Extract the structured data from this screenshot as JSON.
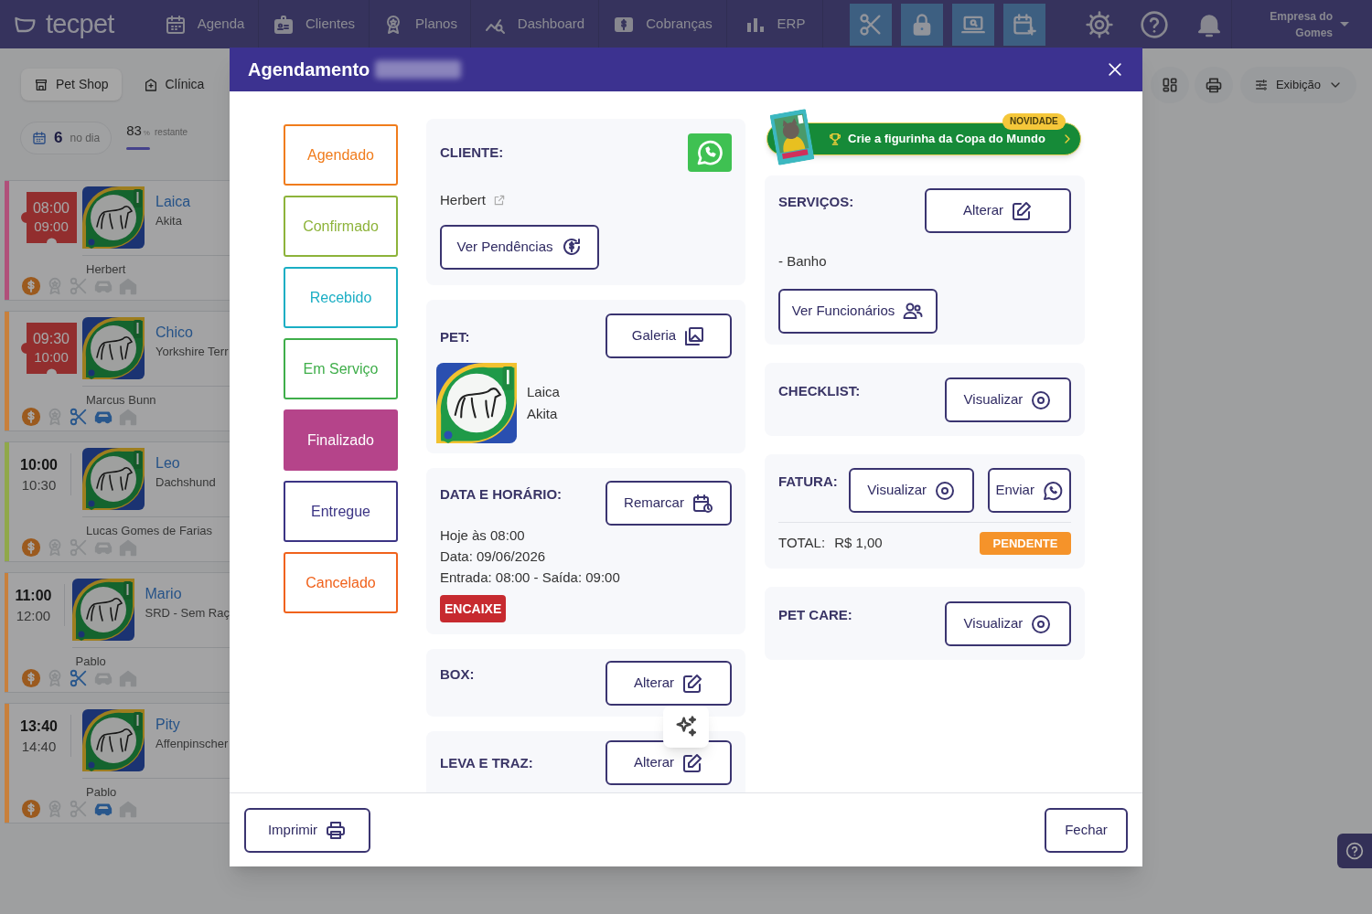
{
  "top_nav": {
    "logo": "tecpet",
    "items": [
      {
        "label": "Agenda"
      },
      {
        "label": "Clientes"
      },
      {
        "label": "Planos"
      },
      {
        "label": "Dashboard"
      },
      {
        "label": "Cobranças"
      },
      {
        "label": "ERP"
      }
    ],
    "account": "Empresa do Gomes"
  },
  "agenda": {
    "tabs": [
      {
        "label": "Pet Shop",
        "selected": true
      },
      {
        "label": "Clínica",
        "selected": false
      }
    ],
    "count": "6",
    "count_label": "no dia",
    "percent": "83",
    "percent_unit": "%",
    "percent_label": "restante",
    "appointments": [
      {
        "start": "08:00",
        "end": "09:00",
        "encaixe": true,
        "color": "#b0507a",
        "pet": "Laica",
        "breed": "Akita",
        "owner": "Herbert",
        "paid": true,
        "plan": false,
        "grooming": false,
        "transport": false,
        "lodging": false
      },
      {
        "start": "09:30",
        "end": "10:00",
        "encaixe": true,
        "color": "#c8803c",
        "pet": "Chico",
        "breed": "Yorkshire Terr",
        "owner": "Marcus Bunn",
        "paid": true,
        "plan": false,
        "grooming": true,
        "transport": true,
        "lodging": false
      },
      {
        "start": "10:00",
        "end": "10:30",
        "encaixe": false,
        "color": "#90a84a",
        "pet": "Leo",
        "breed": "Dachshund",
        "owner": "Lucas Gomes de Farias",
        "paid": true,
        "plan": false,
        "grooming": false,
        "transport": false,
        "lodging": false
      },
      {
        "start": "11:00",
        "end": "12:00",
        "encaixe": false,
        "color": "#c8803c",
        "pet": "Mario",
        "breed": "SRD - Sem Raç",
        "owner": "Pablo",
        "paid": true,
        "plan": false,
        "grooming": true,
        "transport": false,
        "lodging": false
      },
      {
        "start": "13:40",
        "end": "14:40",
        "encaixe": false,
        "color": "#c8803c",
        "pet": "Pity",
        "breed": "Affenpinscher",
        "owner": "Pablo",
        "paid": true,
        "plan": false,
        "grooming": false,
        "transport": true,
        "lodging": false
      }
    ]
  },
  "toolbar": {
    "view_label": "Exibição"
  },
  "modal": {
    "title": "Agendamento",
    "statuses": [
      {
        "label": "Agendado",
        "color": "#f07c1c",
        "selected": false
      },
      {
        "label": "Confirmado",
        "color": "#8db33a",
        "selected": false
      },
      {
        "label": "Recebido",
        "color": "#1aaec4",
        "selected": false
      },
      {
        "label": "Em Serviço",
        "color": "#3fae4a",
        "selected": false
      },
      {
        "label": "Finalizado",
        "color": "#b5448a",
        "selected": true
      },
      {
        "label": "Entregue",
        "color": "#3b3484",
        "selected": false
      },
      {
        "label": "Cancelado",
        "color": "#f0621c",
        "selected": false
      }
    ],
    "client": {
      "heading": "CLIENTE:",
      "name": "Herbert",
      "button": "Ver Pendências"
    },
    "pet": {
      "heading": "PET:",
      "button": "Galeria",
      "name": "Laica",
      "breed": "Akita"
    },
    "schedule": {
      "heading": "DATA E HORÁRIO:",
      "button": "Remarcar",
      "lines": [
        "Hoje às 08:00",
        "Data: 09/06/2026",
        "Entrada: 08:00 - Saída: 09:00"
      ],
      "badge": "ENCAIXE"
    },
    "box": {
      "heading": "BOX:",
      "button": "Alterar"
    },
    "pickup": {
      "heading": "LEVA E TRAZ:",
      "button": "Alterar"
    },
    "promo": {
      "text": "Crie a figurinha da Copa do Mundo",
      "badge": "NOVIDADE"
    },
    "services": {
      "heading": "SERVIÇOS:",
      "button": "Alterar",
      "items": [
        "- Banho"
      ],
      "staff_button": "Ver Funcionários"
    },
    "checklist": {
      "heading": "CHECKLIST:",
      "button": "Visualizar"
    },
    "invoice": {
      "heading": "FATURA:",
      "view_button": "Visualizar",
      "send_button": "Enviar",
      "total_label": "TOTAL:",
      "total": "R$ 1,00",
      "status": "PENDENTE"
    },
    "pet_care": {
      "heading": "PET CARE:",
      "button": "Visualizar"
    },
    "footer": {
      "print": "Imprimir",
      "close": "Fechar"
    }
  }
}
